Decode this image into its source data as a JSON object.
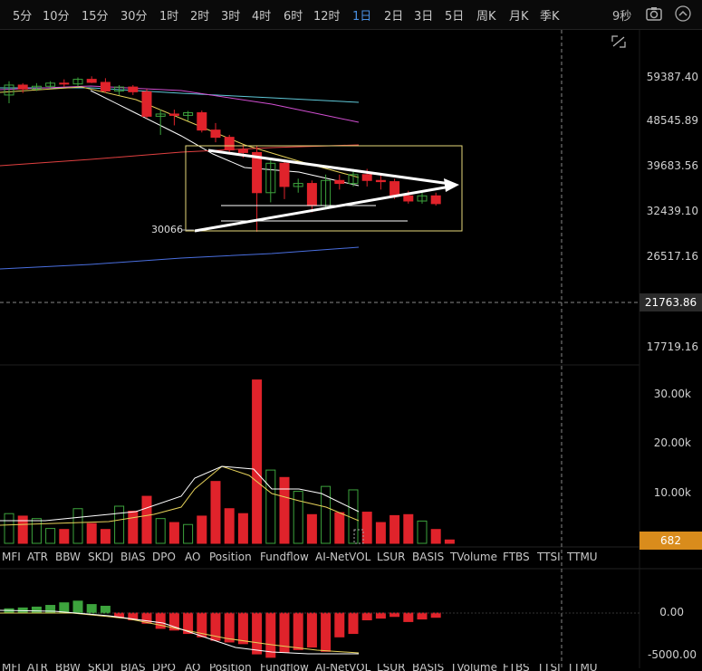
{
  "toolbar": {
    "timeframes": [
      "5分",
      "10分",
      "15分",
      "30分",
      "1时",
      "2时",
      "3时",
      "4时",
      "6时",
      "12时",
      "1日",
      "2日",
      "3日",
      "5日",
      "周K",
      "月K",
      "季K"
    ],
    "active": "1日",
    "refresh": "9秒",
    "icons": [
      "camera-icon",
      "collapse-icon"
    ]
  },
  "price_axis": [
    "59387.40",
    "48545.89",
    "39683.56",
    "32439.10",
    "26517.16",
    "21763.86",
    "17719.16"
  ],
  "current_price": "21763.86",
  "annotation_low": "30066",
  "volume_axis": [
    "30.00k",
    "20.00k",
    "10.00k"
  ],
  "current_volume": "682",
  "indicator_tabs": [
    "MFI",
    "ATR",
    "BBW",
    "SKDJ",
    "BIAS",
    "DPO",
    "AO",
    "Position",
    "Fundflow",
    "AI-NetVOL",
    "LSUR",
    "BASIS",
    "TVolume",
    "FTBS",
    "TTSI",
    "TTMU"
  ],
  "osc_axis": [
    "0.00",
    "-5000.00"
  ],
  "colors": {
    "up": "#3da33d",
    "down": "#e0232b",
    "ma_white": "#ffffff",
    "ma_yellow": "#e6d25a",
    "ma_pink": "#d24fd2",
    "ma_cyan": "#5fc8d8",
    "ma_red": "#e04040",
    "ma_blue": "#4a6fe0",
    "box": "#e6d87a",
    "accent": "#4a90e2",
    "vol_tag": "#d98c1c"
  },
  "chart_data": {
    "type": "candlestick",
    "candles": [
      {
        "o": 55000,
        "h": 58500,
        "l": 53000,
        "c": 57500
      },
      {
        "o": 57500,
        "h": 58000,
        "l": 55500,
        "c": 56500
      },
      {
        "o": 56500,
        "h": 58000,
        "l": 56000,
        "c": 57200
      },
      {
        "o": 57200,
        "h": 58500,
        "l": 56800,
        "c": 58000
      },
      {
        "o": 58000,
        "h": 59000,
        "l": 57000,
        "c": 57800
      },
      {
        "o": 57800,
        "h": 59500,
        "l": 57200,
        "c": 59000
      },
      {
        "o": 59000,
        "h": 59800,
        "l": 58000,
        "c": 58200
      },
      {
        "o": 58200,
        "h": 59300,
        "l": 55500,
        "c": 56000
      },
      {
        "o": 56000,
        "h": 57500,
        "l": 55000,
        "c": 57000
      },
      {
        "o": 57000,
        "h": 57500,
        "l": 55000,
        "c": 55800
      },
      {
        "o": 55800,
        "h": 56500,
        "l": 49500,
        "c": 50000
      },
      {
        "o": 50000,
        "h": 51500,
        "l": 46000,
        "c": 50500
      },
      {
        "o": 50500,
        "h": 51500,
        "l": 48000,
        "c": 50200
      },
      {
        "o": 50200,
        "h": 51200,
        "l": 49000,
        "c": 50800
      },
      {
        "o": 50800,
        "h": 51300,
        "l": 46500,
        "c": 47000
      },
      {
        "o": 47000,
        "h": 48500,
        "l": 44500,
        "c": 45500
      },
      {
        "o": 45500,
        "h": 46000,
        "l": 42500,
        "c": 43000
      },
      {
        "o": 43000,
        "h": 44000,
        "l": 41500,
        "c": 42500
      },
      {
        "o": 42500,
        "h": 43800,
        "l": 29800,
        "c": 35500
      },
      {
        "o": 35500,
        "h": 41500,
        "l": 34000,
        "c": 40500
      },
      {
        "o": 40500,
        "h": 41000,
        "l": 34500,
        "c": 36500
      },
      {
        "o": 36500,
        "h": 37800,
        "l": 35500,
        "c": 37000
      },
      {
        "o": 37000,
        "h": 37500,
        "l": 32500,
        "c": 33500
      },
      {
        "o": 33500,
        "h": 38500,
        "l": 33000,
        "c": 37500
      },
      {
        "o": 37500,
        "h": 38500,
        "l": 36000,
        "c": 37000
      },
      {
        "o": 37000,
        "h": 39500,
        "l": 36500,
        "c": 38500
      },
      {
        "o": 38500,
        "h": 39500,
        "l": 36500,
        "c": 37500
      },
      {
        "o": 37500,
        "h": 38500,
        "l": 36000,
        "c": 37300
      },
      {
        "o": 37300,
        "h": 37800,
        "l": 34500,
        "c": 35000
      },
      {
        "o": 35000,
        "h": 35800,
        "l": 33800,
        "c": 34200
      },
      {
        "o": 34200,
        "h": 35500,
        "l": 33800,
        "c": 35000
      },
      {
        "o": 35000,
        "h": 35500,
        "l": 33500,
        "c": 33800
      }
    ],
    "volumes": [
      6000,
      5500,
      5000,
      3000,
      2800,
      7000,
      4000,
      2800,
      7500,
      6500,
      9500,
      5000,
      4200,
      3800,
      5500,
      12500,
      7000,
      6000,
      33000,
      14800,
      13300,
      10500,
      5800,
      11500,
      6200,
      10800,
      6300,
      4200,
      5600,
      5800,
      4500,
      2800,
      682
    ],
    "osc": [
      500,
      600,
      700,
      900,
      1200,
      1400,
      1000,
      800,
      -500,
      -800,
      -1200,
      -1800,
      -2000,
      -2400,
      -2800,
      -3200,
      -3400,
      -3600,
      -4800,
      -5200,
      -4600,
      -4300,
      -4000,
      -4500,
      -2800,
      -2400,
      -800,
      -600,
      -400,
      -1000,
      -700,
      -500
    ]
  }
}
